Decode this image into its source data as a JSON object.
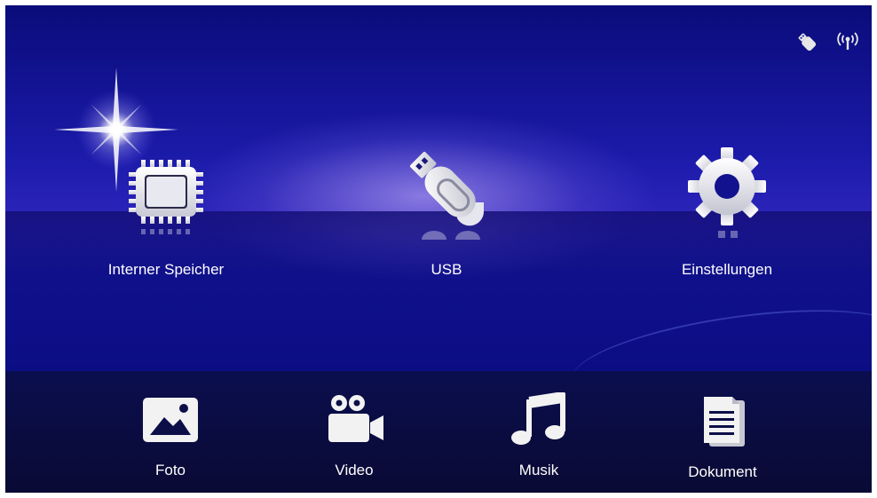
{
  "status_bar": {
    "icons": [
      "usb-stick-icon",
      "wireless-icon"
    ]
  },
  "main_menu": {
    "items": [
      {
        "label": "Interner Speicher",
        "icon": "memory-chip-icon"
      },
      {
        "label": "USB",
        "icon": "usb-drive-icon"
      },
      {
        "label": "Einstellungen",
        "icon": "gear-icon"
      }
    ]
  },
  "media_bar": {
    "items": [
      {
        "label": "Foto",
        "icon": "photo-icon"
      },
      {
        "label": "Video",
        "icon": "video-camera-icon"
      },
      {
        "label": "Musik",
        "icon": "music-note-icon"
      },
      {
        "label": "Dokument",
        "icon": "document-icon"
      }
    ]
  },
  "colors": {
    "background_top": "#0a0c7a",
    "background_glow": "#aa96f0",
    "bottom_bar": "#0a0c3e",
    "text": "#ffffff",
    "icon": "#f2f2f2"
  }
}
